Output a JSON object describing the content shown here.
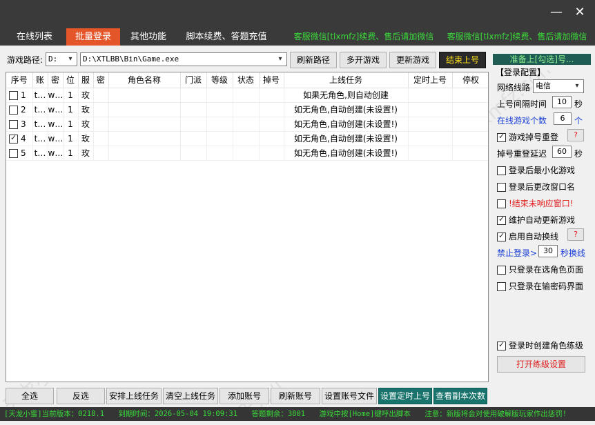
{
  "window": {
    "minimize": "—",
    "close": "✕"
  },
  "tabs": [
    {
      "label": "在线列表"
    },
    {
      "label": "批量登录"
    },
    {
      "label": "其他功能"
    },
    {
      "label": "脚本续费、答题充值"
    },
    {
      "label": "客服微信[tlxmfz]续费、售后请加微信"
    },
    {
      "label": "客服微信[tlxmfz]续费、售后请加微信"
    }
  ],
  "toolbar": {
    "path_label": "游戏路径:",
    "drive": "D:",
    "path": "D:\\XTLBB\\Bin\\Game.exe",
    "refresh_path": "刷新路径",
    "multi_open": "多开游戏",
    "update_game": "更新游戏",
    "end_login": "结束上号"
  },
  "table": {
    "headers": [
      "序号",
      "账",
      "密",
      "位",
      "服",
      "密",
      "角色名称",
      "门派",
      "等级",
      "状态",
      "掉号",
      "上线任务",
      "定时上号",
      "停权"
    ],
    "rows": [
      {
        "num": "1",
        "acct": "t…",
        "pwd": "w…",
        "pos": "1",
        "server": "玫",
        "task": "如果无角色,则自动创建",
        "checked": false
      },
      {
        "num": "2",
        "acct": "t…",
        "pwd": "w…",
        "pos": "1",
        "server": "玫",
        "task": "如无角色,自动创建(未设置!)",
        "checked": false
      },
      {
        "num": "3",
        "acct": "t…",
        "pwd": "w…",
        "pos": "1",
        "server": "玫",
        "task": "如无角色,自动创建(未设置!)",
        "checked": false
      },
      {
        "num": "4",
        "acct": "t…",
        "pwd": "w…",
        "pos": "1",
        "server": "玫",
        "task": "如无角色,自动创建(未设置!)",
        "checked": true
      },
      {
        "num": "5",
        "acct": "t…",
        "pwd": "w…",
        "pos": "1",
        "server": "玫",
        "task": "如无角色,自动创建(未设置!)",
        "checked": false
      }
    ]
  },
  "panel": {
    "head": "准备上[勾选]号...",
    "section": "【登录配置】",
    "line_label": "网络线路",
    "line_value": "电信",
    "interval_label": "上号间隔时间",
    "interval_value": "10",
    "interval_unit": "秒",
    "online_label": "在线游戏个数",
    "online_value": "6",
    "online_unit": "个",
    "redial_drop": "游戏掉号重登",
    "redial_delay_label": "掉号重登延迟",
    "redial_delay_value": "60",
    "redial_delay_unit": "秒",
    "minimize": "登录后最小化游戏",
    "rename": "登录后更改窗口名",
    "kill_unresp": "!结束未响应窗口!",
    "auto_update": "维护自动更新游戏",
    "auto_switch": "启用自动换线",
    "forbid_label": "禁止登录>",
    "forbid_value": "30",
    "forbid_unit": "秒换线",
    "only_select": "只登录在选角色页面",
    "only_pwd": "只登录在输密码界面",
    "create_level": "登录时创建角色练级",
    "open_level": "打开练级设置",
    "q": "?"
  },
  "bottom": {
    "select_all": "全选",
    "invert": "反选",
    "arrange_task": "安排上线任务",
    "clear_task": "清空上线任务",
    "add_account": "添加账号",
    "refresh_account": "刷新账号",
    "set_file": "设置账号文件",
    "timed_login": "设置定时上号",
    "view_dungeon": "查看副本次数"
  },
  "status": {
    "version": "[天龙小蜜]当前版本：0218.1",
    "expire": "到期时间：2026-05-04 19:09:31",
    "answers": "答题剩余：3801",
    "hotkey": "游戏中按[Home]键呼出脚本",
    "notice": "注意：新版将会对使用破解版玩家作出惩罚!"
  },
  "watermark": "天龙小蜜官网 www.tlxmfz.com"
}
